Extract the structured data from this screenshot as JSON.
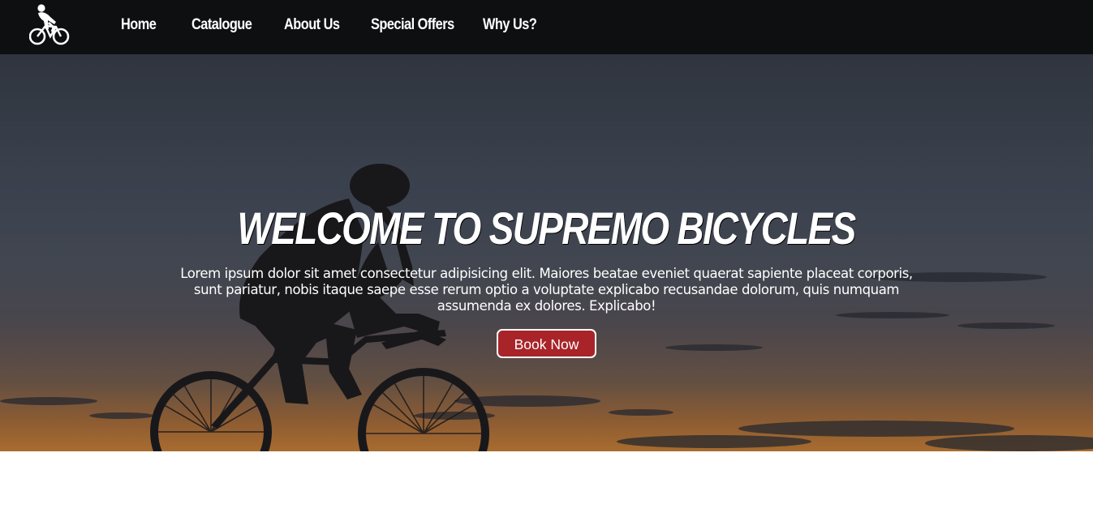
{
  "nav": {
    "logo_icon": "cyclist-icon",
    "items": [
      {
        "label": "Home"
      },
      {
        "label": "Catalogue"
      },
      {
        "label": "About Us"
      },
      {
        "label": "Special Offers"
      },
      {
        "label": "Why Us?"
      }
    ]
  },
  "hero": {
    "background_image": "cyclist-silhouette-sunset",
    "title": "WELCOME TO SUPREMO BICYCLES",
    "text": "Lorem ipsum dolor sit amet consectetur adipisicing elit. Maiores beatae eveniet quaerat sapiente placeat corporis, sunt pariatur, nobis itaque saepe esse rerum optio a voluptate explicabo recusandae dolorum, quis numquam assumenda ex dolores. Explicabo!",
    "button_label": "Book Now"
  },
  "colors": {
    "navbar_bg": "#0e0f11",
    "button_bg": "#a82429",
    "text": "#ffffff"
  }
}
